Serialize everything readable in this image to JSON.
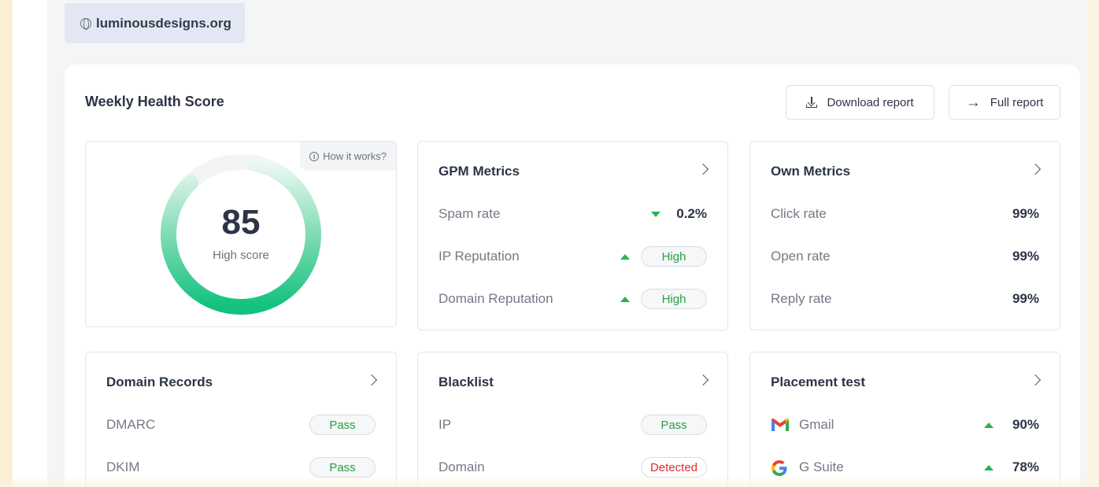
{
  "domain": "luminousdesigns.org",
  "panel": {
    "title": "Weekly Health Score",
    "download_label": "Download report",
    "full_label": "Full report"
  },
  "score": {
    "value": "85",
    "label": "High score",
    "how_it_works": "How it works?",
    "fraction": 0.85
  },
  "gpm": {
    "title": "GPM Metrics",
    "rows": [
      {
        "label": "Spam rate",
        "value": "0.2%",
        "trend": "down"
      },
      {
        "label": "IP Reputation",
        "value": "High",
        "trend": "up"
      },
      {
        "label": "Domain Reputation",
        "value": "High",
        "trend": "up"
      }
    ]
  },
  "own": {
    "title": "Own Metrics",
    "rows": [
      {
        "label": "Click rate",
        "value": "99%"
      },
      {
        "label": "Open rate",
        "value": "99%"
      },
      {
        "label": "Reply rate",
        "value": "99%"
      }
    ]
  },
  "records": {
    "title": "Domain Records",
    "rows": [
      {
        "label": "DMARC",
        "value": "Pass"
      },
      {
        "label": "DKIM",
        "value": "Pass"
      }
    ]
  },
  "blacklist": {
    "title": "Blacklist",
    "rows": [
      {
        "label": "IP",
        "value": "Pass"
      },
      {
        "label": "Domain",
        "value": "Detected"
      }
    ]
  },
  "placement": {
    "title": "Placement test",
    "rows": [
      {
        "label": "Gmail",
        "value": "90%",
        "icon": "gmail-icon"
      },
      {
        "label": "G Suite",
        "value": "78%",
        "icon": "google-icon"
      }
    ]
  },
  "colors": {
    "accent_green": "#2bb24c",
    "ring_green": "#17c582",
    "danger": "#e02d2d",
    "chip_bg": "#e3e7f3"
  }
}
